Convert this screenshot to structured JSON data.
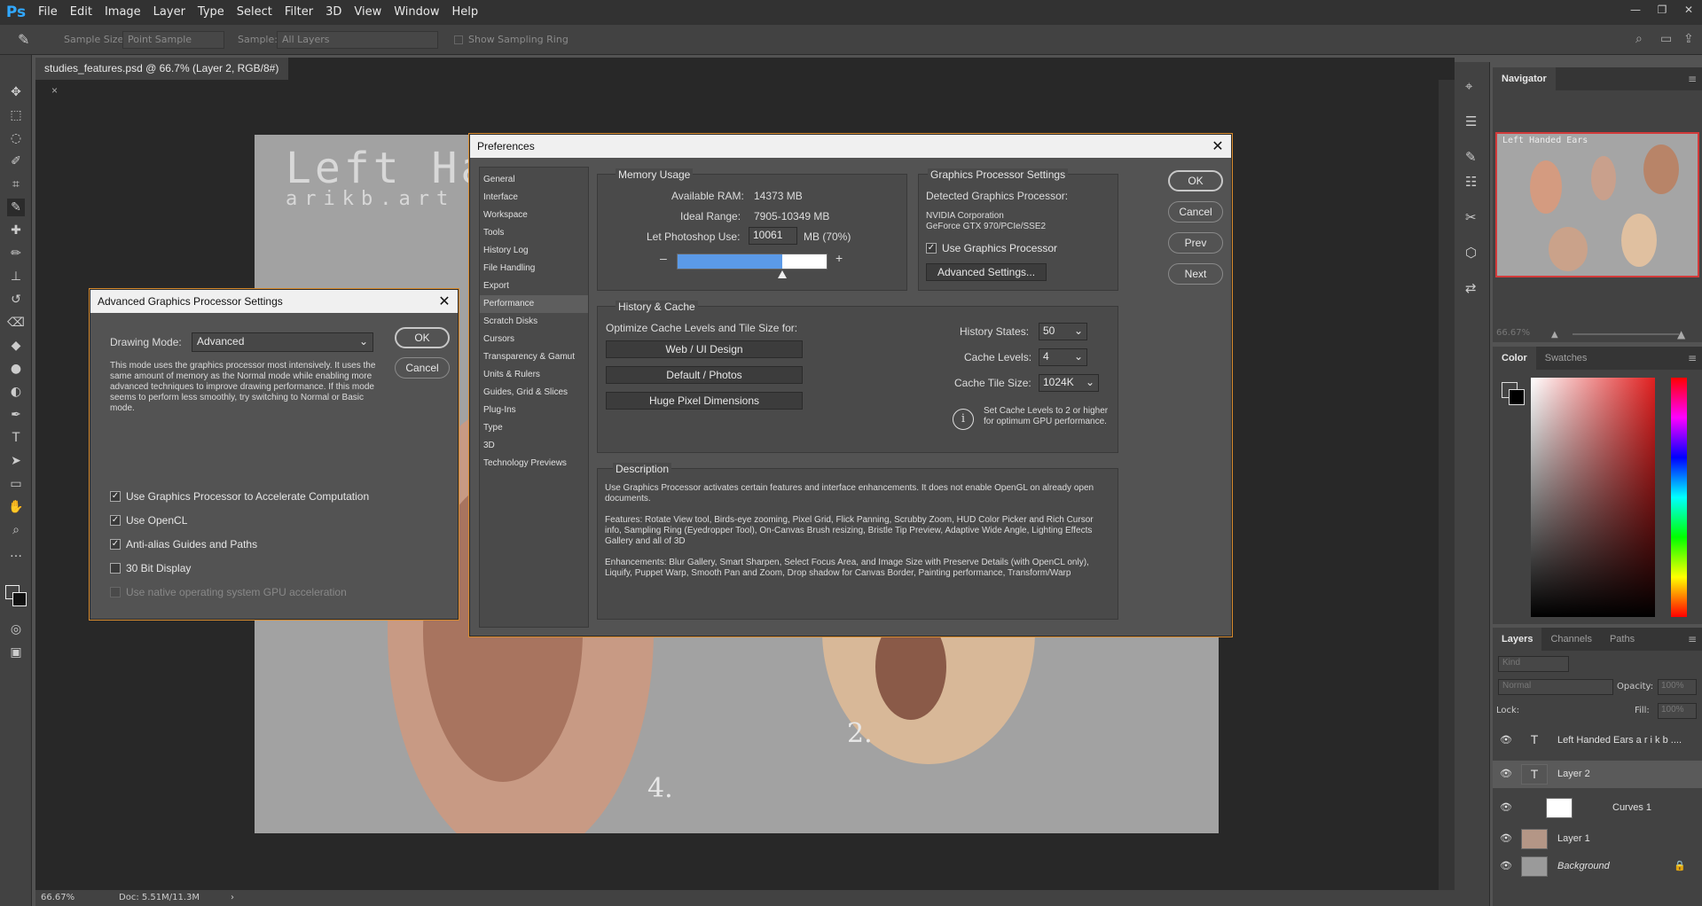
{
  "app": {
    "logo": "Ps"
  },
  "menu": [
    "File",
    "Edit",
    "Image",
    "Layer",
    "Type",
    "Select",
    "Filter",
    "3D",
    "View",
    "Window",
    "Help"
  ],
  "window_controls": {
    "minimize": "—",
    "restore": "❐",
    "close": "✕"
  },
  "options_bar": {
    "sample_size_label": "Sample Size:",
    "sample_size_value": "Point Sample",
    "sample_label": "Sample:",
    "sample_value": "All Layers",
    "show_ring_label": "Show Sampling Ring"
  },
  "document_tab": {
    "title": "studies_features.psd @ 66.7% (Layer 2, RGB/8#)",
    "close": "×"
  },
  "canvas": {
    "title": "Left Ha",
    "subtitle": "arikb.art",
    "label_two": "2.",
    "label_four": "4."
  },
  "statusbar": {
    "zoom": "66.67%",
    "doc": "Doc: 5.51M/11.3M"
  },
  "navigator": {
    "tab": "Navigator",
    "zoom": "66.67%",
    "thumb_title": "Left Handed Ears"
  },
  "color_panel": {
    "tabs": [
      "Color",
      "Swatches"
    ]
  },
  "layers_panel": {
    "tabs": [
      "Layers",
      "Channels",
      "Paths"
    ],
    "kind_placeholder": "Kind",
    "blend_mode": "Normal",
    "opacity_label": "Opacity:",
    "opacity_value": "100%",
    "lock_label": "Lock:",
    "fill_label": "Fill:",
    "fill_value": "100%",
    "layers": [
      {
        "name": "Left Handed Ears a r i k b ....",
        "thumb": "T"
      },
      {
        "name": "Layer 2",
        "thumb": "T"
      },
      {
        "name": "Curves 1",
        "thumb": ""
      },
      {
        "name": "Layer 1",
        "thumb": ""
      },
      {
        "name": "Background",
        "thumb": ""
      }
    ]
  },
  "adv_dialog": {
    "title": "Advanced Graphics Processor Settings",
    "drawing_mode_label": "Drawing Mode:",
    "drawing_mode_value": "Advanced",
    "ok": "OK",
    "cancel": "Cancel",
    "description": "This mode uses the graphics processor most intensively.  It uses the same amount of memory as the Normal mode while enabling more advanced techniques to improve drawing performance.  If this mode seems to perform less smoothly, try switching to Normal or Basic mode.",
    "options": [
      {
        "label": "Use Graphics Processor to Accelerate Computation",
        "checked": true
      },
      {
        "label": "Use OpenCL",
        "checked": true
      },
      {
        "label": "Anti-alias Guides and Paths",
        "checked": true
      },
      {
        "label": "30 Bit Display",
        "checked": false
      },
      {
        "label": "Use native operating system GPU acceleration",
        "checked": false,
        "disabled": true
      }
    ]
  },
  "prefs": {
    "title": "Preferences",
    "sections": [
      "General",
      "Interface",
      "Workspace",
      "Tools",
      "History Log",
      "File Handling",
      "Export",
      "Performance",
      "Scratch Disks",
      "Cursors",
      "Transparency & Gamut",
      "Units & Rulers",
      "Guides, Grid & Slices",
      "Plug-Ins",
      "Type",
      "3D",
      "Technology Previews"
    ],
    "active_section": "Performance",
    "buttons": {
      "ok": "OK",
      "cancel": "Cancel",
      "prev": "Prev",
      "next": "Next"
    },
    "memory": {
      "title": "Memory Usage",
      "available_label": "Available RAM:",
      "available_value": "14373 MB",
      "ideal_label": "Ideal Range:",
      "ideal_value": "7905-10349 MB",
      "let_label": "Let Photoshop Use:",
      "let_value": "10061",
      "let_unit": "MB (70%)",
      "slider_fraction": 0.7,
      "minus": "–",
      "plus": "+"
    },
    "gpu": {
      "title": "Graphics Processor Settings",
      "detected_label": "Detected Graphics Processor:",
      "vendor": "NVIDIA Corporation",
      "model": "GeForce GTX 970/PCIe/SSE2",
      "use_label": "Use Graphics Processor",
      "advanced_button": "Advanced Settings..."
    },
    "history_cache": {
      "title": "History & Cache",
      "optimize_label": "Optimize Cache Levels and Tile Size for:",
      "presets": [
        "Web / UI Design",
        "Default / Photos",
        "Huge Pixel Dimensions"
      ],
      "history_states_label": "History States:",
      "history_states_value": "50",
      "cache_levels_label": "Cache Levels:",
      "cache_levels_value": "4",
      "tile_size_label": "Cache Tile Size:",
      "tile_size_value": "1024K",
      "info_icon": "i",
      "info_text": "Set Cache Levels to 2 or higher for optimum GPU performance."
    },
    "description": {
      "title": "Description",
      "p1": "Use Graphics Processor activates certain features and interface enhancements. It does not enable OpenGL on already open documents.",
      "p2": "Features: Rotate View tool, Birds-eye zooming, Pixel Grid, Flick Panning, Scrubby Zoom, HUD Color Picker and Rich Cursor info, Sampling Ring (Eyedropper Tool), On-Canvas Brush resizing, Bristle Tip Preview, Adaptive Wide Angle, Lighting Effects Gallery and all of 3D",
      "p3": "Enhancements: Blur Gallery, Smart Sharpen, Select Focus Area, and Image Size with Preserve Details (with OpenCL only), Liquify, Puppet Warp, Smooth Pan and Zoom, Drop shadow for Canvas Border, Painting performance, Transform/Warp"
    }
  }
}
